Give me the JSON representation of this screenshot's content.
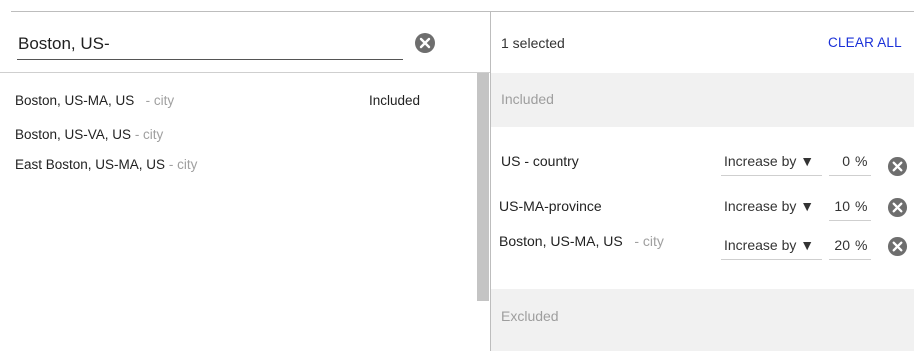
{
  "search": {
    "value": "Boston, US-"
  },
  "results": [
    {
      "name": "Boston, US-MA, US",
      "type": "- city",
      "status": "Included"
    },
    {
      "name": "Boston, US-VA, US",
      "type": "- city",
      "status": ""
    },
    {
      "name": "East Boston, US-MA, US",
      "type": "- city",
      "status": ""
    }
  ],
  "selection": {
    "count_label": "1 selected",
    "clear_all": "CLEAR ALL",
    "included_label": "Included",
    "excluded_label": "Excluded",
    "included_items": [
      {
        "name": "US - country",
        "type": "",
        "mode": "Increase by",
        "value": "0",
        "unit": "%"
      },
      {
        "name": "US-MA-province",
        "type": "",
        "mode": "Increase by",
        "value": "10",
        "unit": "%"
      },
      {
        "name": "Boston, US-MA, US",
        "type": "- city",
        "mode": "Increase by",
        "value": "20",
        "unit": "%"
      }
    ]
  },
  "icons": {
    "clear": "clear-circle-icon",
    "dropdown": "caret-down-icon"
  },
  "colors": {
    "link": "#1a30d8",
    "muted": "#a0a0a0",
    "band": "#f1f1f1",
    "icon": "#6e6e6e"
  }
}
